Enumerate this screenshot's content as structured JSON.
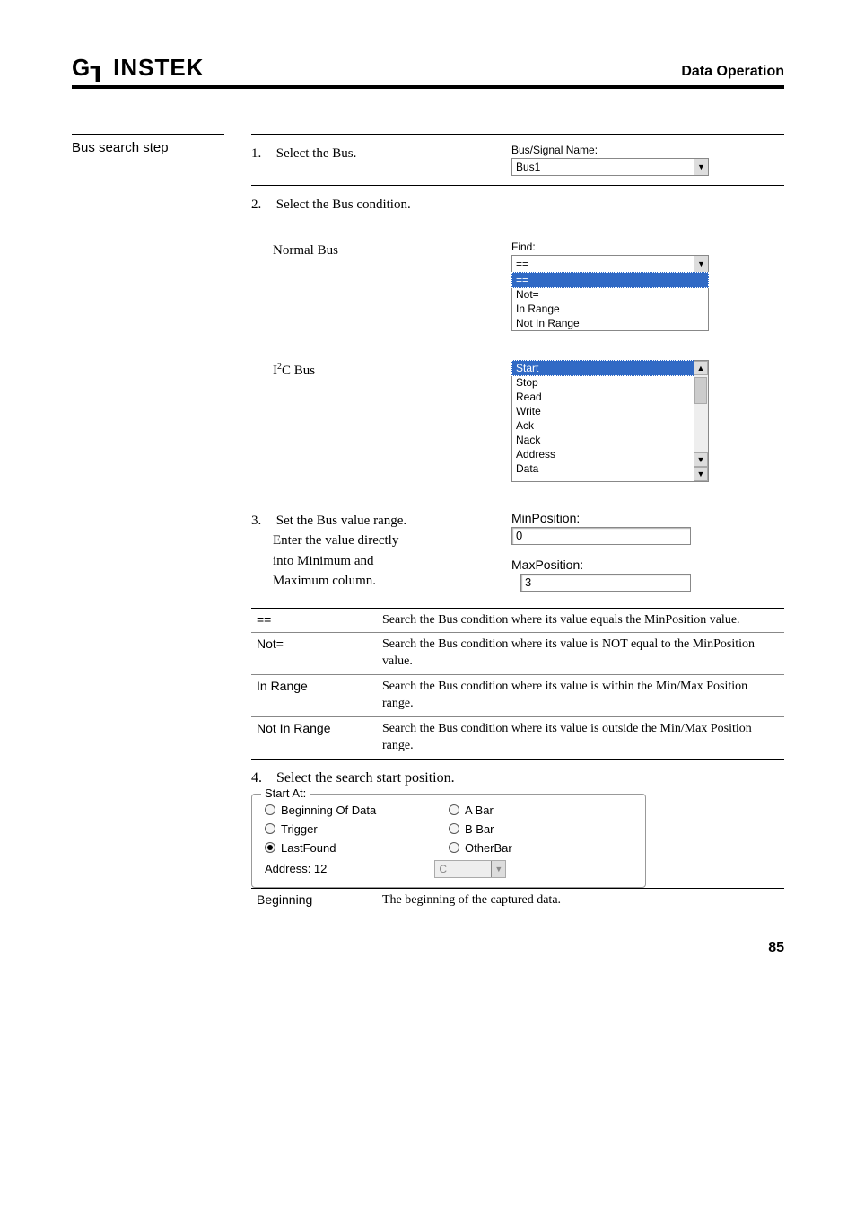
{
  "header": {
    "logo": "G┒ INSTEK",
    "title": "Data Operation"
  },
  "left_heading": "Bus search step",
  "step1": {
    "num": "1.",
    "text": "Select the Bus.",
    "field_label": "Bus/Signal Name:",
    "value": "Bus1"
  },
  "step2": {
    "num": "2.",
    "text": "Select the Bus condition."
  },
  "normal_bus": {
    "label": "Normal Bus",
    "find_label": "Find:",
    "selected": "==",
    "options": [
      "==",
      "Not=",
      "In Range",
      "Not In Range"
    ]
  },
  "i2c_bus": {
    "label_pre": "I",
    "label_sup": "2",
    "label_post": "C Bus",
    "options": [
      "Start",
      "Stop",
      "Read",
      "Write",
      "Ack",
      "Nack",
      "Address",
      "Data"
    ]
  },
  "step3": {
    "num": "3.",
    "text_lines": [
      "Set the Bus value range.",
      "Enter the value directly",
      "into Minimum and",
      "Maximum column."
    ],
    "min_label": "MinPosition:",
    "min_val": "0",
    "max_label": "MaxPosition:",
    "max_val": "3"
  },
  "defs": [
    {
      "k": "==",
      "v": "Search the Bus condition where its value equals the MinPosition value."
    },
    {
      "k": "Not=",
      "v": "Search the Bus condition where its value is NOT equal to the MinPosition value."
    },
    {
      "k": "In Range",
      "v": "Search the Bus condition where its value is within the Min/Max Position range."
    },
    {
      "k": "Not In Range",
      "v": "Search the Bus condition where its value is outside the Min/Max Position range."
    }
  ],
  "step4": {
    "num": "4.",
    "text": "Select the search start position.",
    "group_title": "Start At:",
    "radios_left": [
      "Beginning Of Data",
      "Trigger",
      "LastFound"
    ],
    "radios_right": [
      "A Bar",
      "B Bar",
      "OtherBar"
    ],
    "selected": "LastFound",
    "addr_label": "Address: 12",
    "dd_val": "C"
  },
  "beginning_row": {
    "k": "Beginning",
    "v": "The beginning of the captured data."
  },
  "page_number": "85"
}
